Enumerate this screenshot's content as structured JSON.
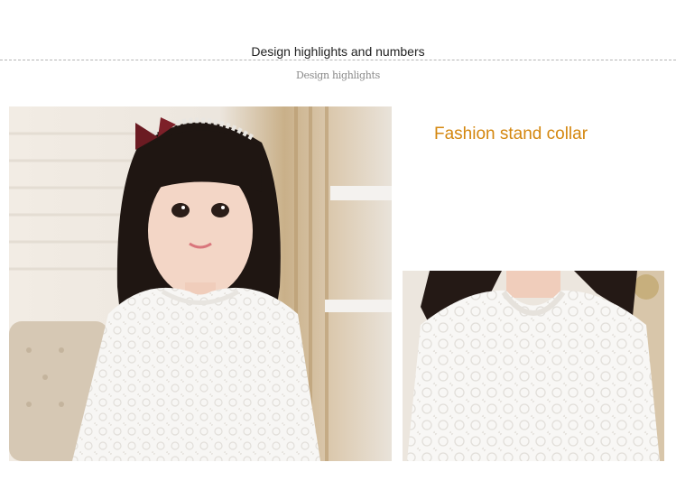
{
  "heading": {
    "title": "Design highlights and numbers"
  },
  "subtitle": "Design highlights",
  "feature": {
    "title": "Fashion stand collar"
  },
  "faint_text": {
    "line1": "",
    "line2": ""
  },
  "images": {
    "main": "photo-girl-white-lace-dress",
    "detail": "photo-collar-closeup"
  },
  "colors": {
    "accent": "#d4870f",
    "text": "#222222",
    "muted": "#8a8a8a"
  }
}
